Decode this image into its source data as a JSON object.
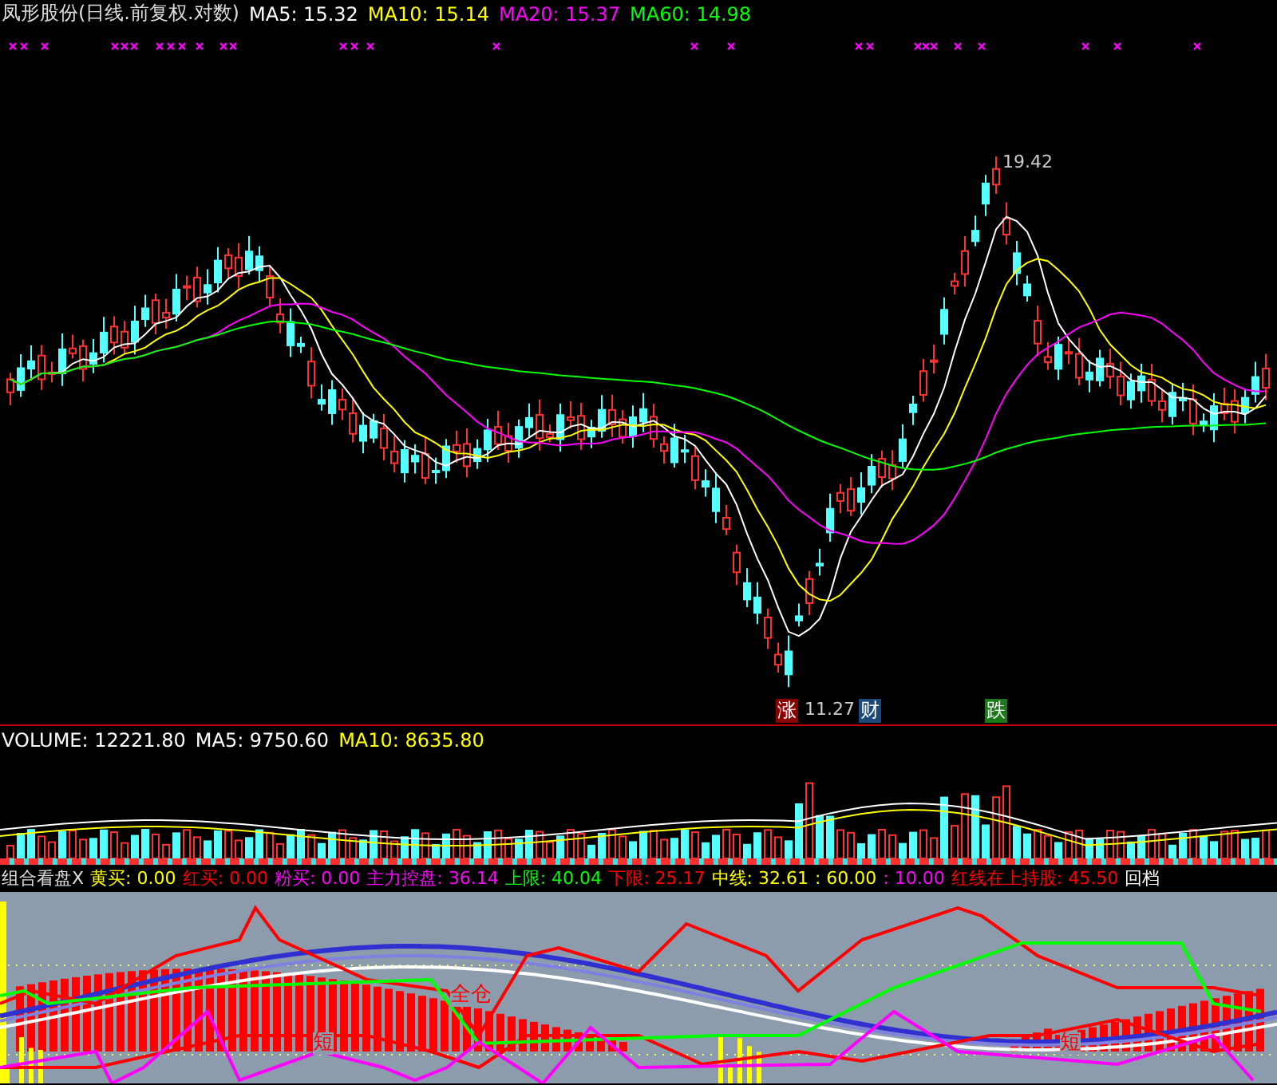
{
  "main_chart": {
    "title": "凤形股份(日线.前复权.对数)",
    "indicators": [
      {
        "label": "MA5: 15.32",
        "color": "#ffffff"
      },
      {
        "label": "MA10: 15.14",
        "color": "#ffff00"
      },
      {
        "label": "MA20: 15.37",
        "color": "#ff00ff"
      },
      {
        "label": "MA60: 14.98",
        "color": "#00ff00"
      }
    ],
    "high_label": "19.42",
    "low_label": "11.27",
    "markers": [
      {
        "text": "涨",
        "color": "#8b0000"
      },
      {
        "text": "财",
        "color": "#1c4a78"
      },
      {
        "text": "跌",
        "color": "#1a7a1a"
      }
    ]
  },
  "volume_chart": {
    "indicators": [
      {
        "label": "VOLUME: 12221.80",
        "color": "#ffffff"
      },
      {
        "label": "MA5: 9750.60",
        "color": "#ffffff"
      },
      {
        "label": "MA10: 8635.80",
        "color": "#ffff00"
      }
    ]
  },
  "indicator_panel": {
    "title": "组合看盘X",
    "indicators": [
      {
        "label": "黄买: 0.00",
        "color": "#ffff00"
      },
      {
        "label": "红买: 0.00",
        "color": "#ff0000"
      },
      {
        "label": "粉买: 0.00",
        "color": "#ff00ff"
      },
      {
        "label": "主力控盘: 36.14",
        "color": "#ff00ff"
      },
      {
        "label": "上限: 40.04",
        "color": "#00ff00"
      },
      {
        "label": "下限: 25.17",
        "color": "#ff0000"
      },
      {
        "label": "中线: 32.61",
        "color": "#ffff00"
      },
      {
        "label": ": 60.00",
        "color": "#ffff00"
      },
      {
        "label": ": 10.00",
        "color": "#ff00ff"
      },
      {
        "label": "红线在上持股: 45.50",
        "color": "#ff0000"
      },
      {
        "label": "回档",
        "color": "#ffffff"
      }
    ],
    "annotations": [
      "全仓",
      "短",
      "短"
    ]
  }
}
